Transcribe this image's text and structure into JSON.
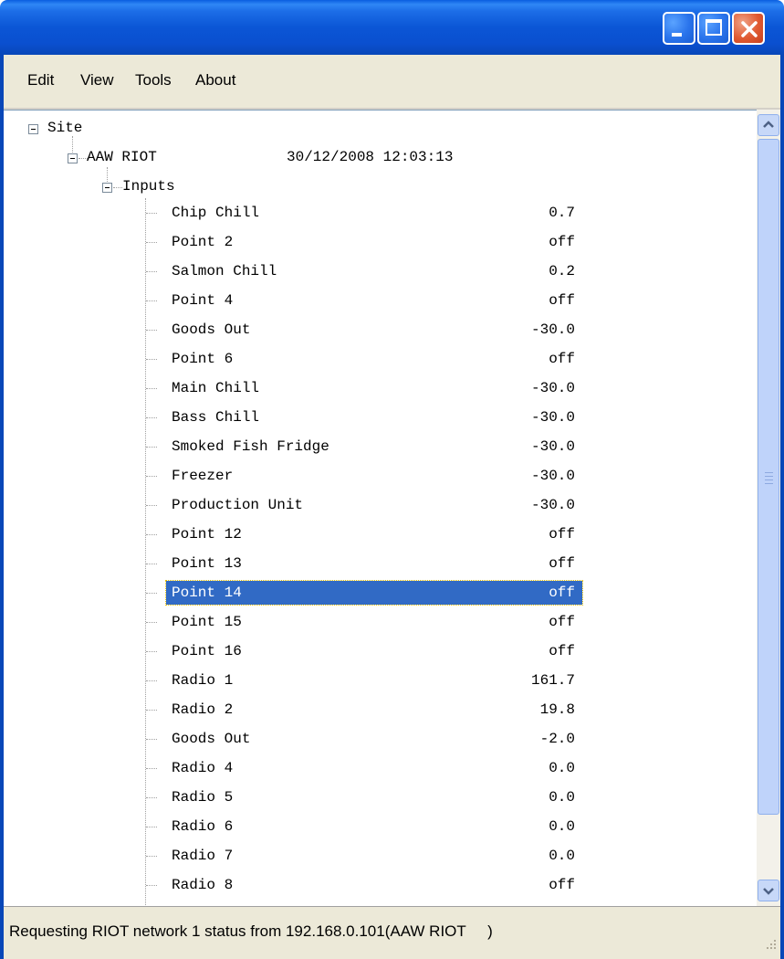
{
  "window": {
    "title": ""
  },
  "menu": [
    "Edit",
    "View",
    "Tools",
    "About"
  ],
  "tree": {
    "root_label": "Site",
    "device": {
      "name": "AAW RIOT",
      "timestamp": "30/12/2008 12:03:13"
    },
    "group_label": "Inputs",
    "inputs": [
      {
        "label": "Chip Chill",
        "value": "0.7"
      },
      {
        "label": "Point 2",
        "value": "off"
      },
      {
        "label": "Salmon Chill",
        "value": "0.2"
      },
      {
        "label": "Point 4",
        "value": "off"
      },
      {
        "label": "Goods Out",
        "value": "-30.0"
      },
      {
        "label": "Point 6",
        "value": "off"
      },
      {
        "label": "Main Chill",
        "value": "-30.0"
      },
      {
        "label": "Bass Chill",
        "value": "-30.0"
      },
      {
        "label": "Smoked Fish Fridge",
        "value": "-30.0"
      },
      {
        "label": "Freezer",
        "value": "-30.0"
      },
      {
        "label": "Production Unit",
        "value": "-30.0"
      },
      {
        "label": "Point 12",
        "value": "off"
      },
      {
        "label": "Point 13",
        "value": "off"
      },
      {
        "label": "Point 14",
        "value": "off"
      },
      {
        "label": "Point 15",
        "value": "off"
      },
      {
        "label": "Point 16",
        "value": "off"
      },
      {
        "label": "Radio 1",
        "value": "161.7"
      },
      {
        "label": "Radio 2",
        "value": "19.8"
      },
      {
        "label": "Goods Out",
        "value": "-2.0"
      },
      {
        "label": "Radio 4",
        "value": "0.0"
      },
      {
        "label": "Radio 5",
        "value": "0.0"
      },
      {
        "label": "Radio 6",
        "value": "0.0"
      },
      {
        "label": "Radio 7",
        "value": "0.0"
      },
      {
        "label": "Radio 8",
        "value": "off"
      }
    ],
    "selected_index": 13
  },
  "status": {
    "text": "Requesting RIOT network 1 status from 192.168.0.101(AAW RIOT     )"
  },
  "colors": {
    "titlebar": "#0a4fcf",
    "selection": "#316ac5",
    "chrome": "#ece9d8"
  }
}
